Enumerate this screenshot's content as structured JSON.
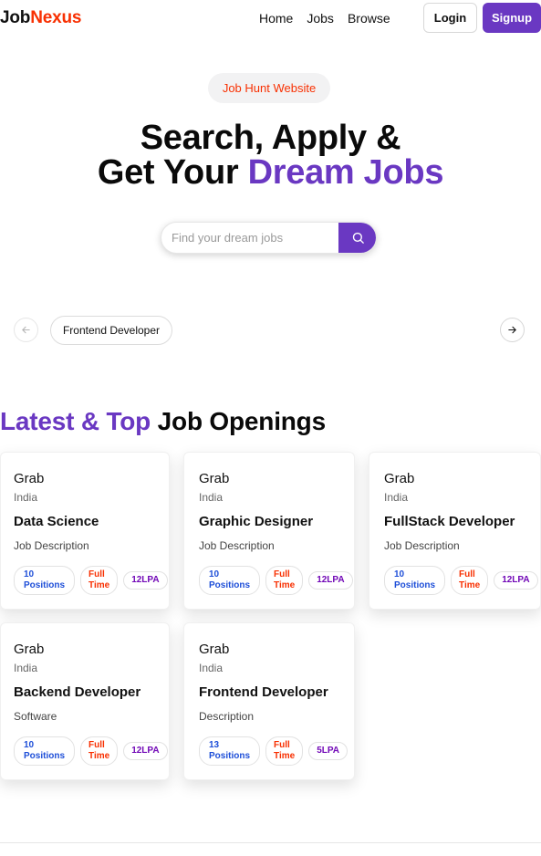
{
  "nav": {
    "logo_a": "Job",
    "logo_b": "Nexus",
    "links": [
      "Home",
      "Jobs",
      "Browse"
    ],
    "login_label": "Login",
    "signup_label": "Signup"
  },
  "hero": {
    "badge": "Job Hunt Website",
    "title_line1": "Search, Apply &",
    "title_line2_a": "Get Your ",
    "title_line2_b": "Dream Jobs",
    "search_placeholder": "Find your dream jobs"
  },
  "carousel": {
    "items": [
      "Frontend Developer"
    ]
  },
  "section": {
    "title_a": "Latest & Top",
    "title_b": " Job Openings"
  },
  "jobs": [
    {
      "company": "Grab",
      "location": "India",
      "title": "Data Science",
      "description": "Job Description",
      "positions_num": "10",
      "positions_label": "Positions",
      "type_a": "Full",
      "type_b": "Time",
      "salary": "12LPA"
    },
    {
      "company": "Grab",
      "location": "India",
      "title": "Graphic Designer",
      "description": "Job Description",
      "positions_num": "10",
      "positions_label": "Positions",
      "type_a": "Full",
      "type_b": "Time",
      "salary": "12LPA"
    },
    {
      "company": "Grab",
      "location": "India",
      "title": "FullStack Developer",
      "description": "Job Description",
      "positions_num": "10",
      "positions_label": "Positions",
      "type_a": "Full",
      "type_b": "Time",
      "salary": "12LPA"
    },
    {
      "company": "Grab",
      "location": "India",
      "title": "Backend Developer",
      "description": "Software",
      "positions_num": "10",
      "positions_label": "Positions",
      "type_a": "Full",
      "type_b": "Time",
      "salary": "12LPA"
    },
    {
      "company": "Grab",
      "location": "India",
      "title": "Frontend Developer",
      "description": "Description",
      "positions_num": "13",
      "positions_label": "Positions",
      "type_a": "Full",
      "type_b": "Time",
      "salary": "5LPA"
    }
  ],
  "colors": {
    "brand_purple": "#6A38C2",
    "brand_red": "#F83002",
    "positions_blue": "#1d4ed8",
    "salary_purple": "#7209b7"
  }
}
